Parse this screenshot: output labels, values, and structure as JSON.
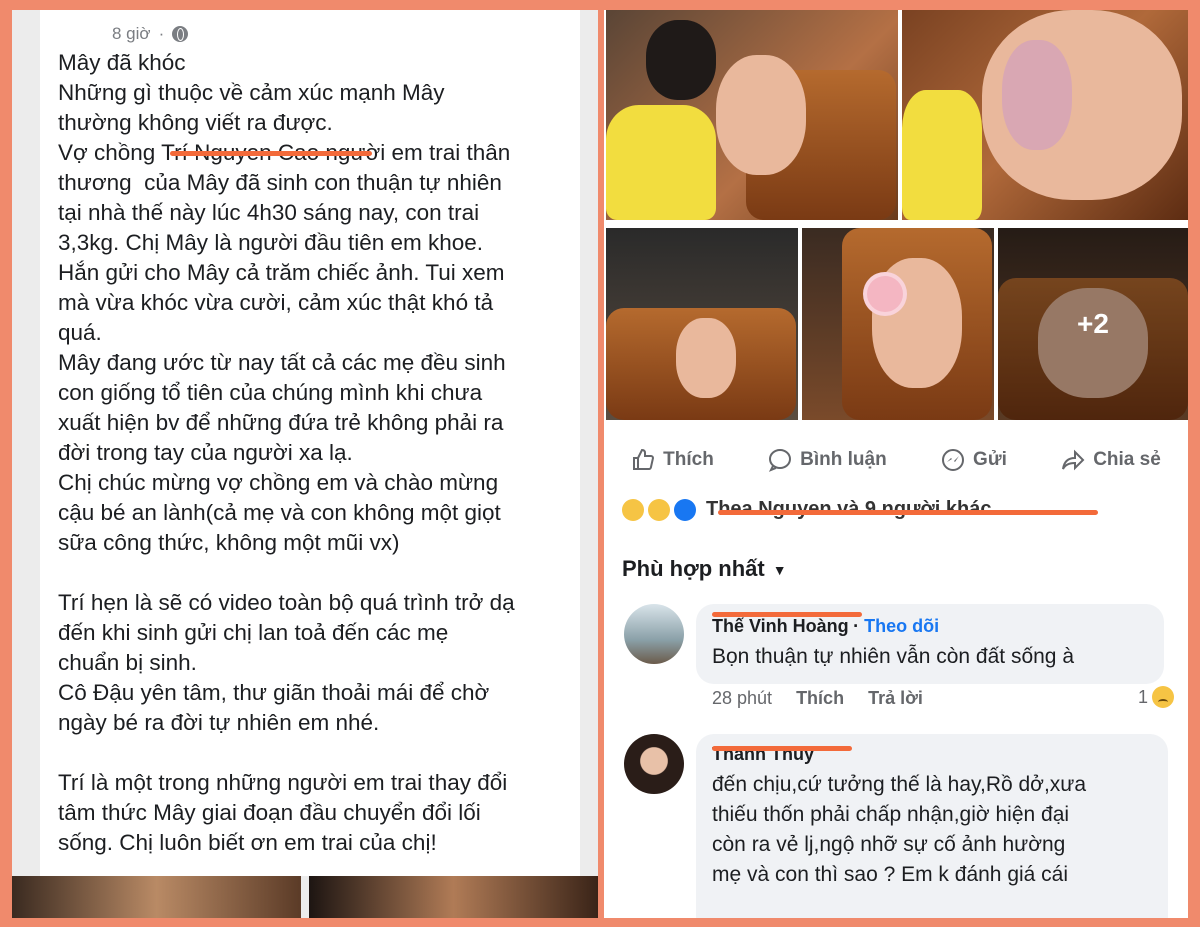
{
  "post": {
    "time": "8 giờ",
    "lines": [
      "Mây đã khóc",
      "Những gì thuộc về cảm xúc mạnh Mây",
      "thường không viết ra được.",
      "Vợ chồng Trí Nguyen Cao người em trai thân",
      "thương  của Mây đã sinh con thuận tự nhiên",
      "tại nhà thế này lúc 4h30 sáng nay, con trai",
      "3,3kg. Chị Mây là người đầu tiên em khoe.",
      "Hắn gửi cho Mây cả trăm chiếc ảnh. Tui xem",
      "mà vừa khóc vừa cười, cảm xúc thật khó tả",
      "quá.",
      "Mây đang ước từ nay tất cả các mẹ đều sinh",
      "con giống tổ tiên của chúng mình khi chưa",
      "xuất hiện bv để những đứa trẻ không phải ra",
      "đời trong tay của người xa lạ.",
      "Chị chúc mừng vợ chồng em và chào mừng",
      "cậu bé an lành(cả mẹ và con không một giọt",
      "sữa công thức, không một mũi vx)",
      "",
      "Trí hẹn là sẽ có video toàn bộ quá trình trở dạ",
      "đến khi sinh gửi chị lan toả đến các mẹ",
      "chuẩn bị sinh.",
      "Cô Đậu yên tâm, thư giãn thoải mái để chờ",
      "ngày bé ra đời tự nhiên em nhé.",
      "",
      "Trí là một trong những người em trai thay đổi",
      "tâm thức Mây giai đoạn đầu chuyển đổi lối",
      "sống. Chị luôn biết ơn em trai của chị!"
    ]
  },
  "photos": {
    "more_count": "+2"
  },
  "actions": {
    "like": "Thích",
    "comment": "Bình luận",
    "send": "Gửi",
    "share": "Chia sẻ"
  },
  "reactions": {
    "summary": "Thea Nguyen và 9 người khác"
  },
  "sort": {
    "label": "Phù hợp nhất"
  },
  "comments": [
    {
      "name": "Thế Vinh Hoàng",
      "follow": "Theo dõi",
      "text": "Bọn thuận tự nhiên vẫn còn đất sống à",
      "time": "28 phút",
      "like": "Thích",
      "reply": "Trả lời",
      "reaction_count": "1"
    },
    {
      "name": "Thanh Thúy",
      "lines": [
        "đến chịu,cứ tưởng thế là hay,Rồ dở,xưa",
        "thiếu thốn phải chấp nhận,giờ hiện đại",
        "còn ra vẻ lj,ngộ nhỡ sự cố ảnh hường",
        "mẹ và con thì sao ? Em k đánh giá cái"
      ]
    }
  ],
  "colors": {
    "frame": "#f08a6c",
    "redaction": "#f36a3a",
    "link_blue": "#1877f2",
    "muted": "#65676b"
  }
}
